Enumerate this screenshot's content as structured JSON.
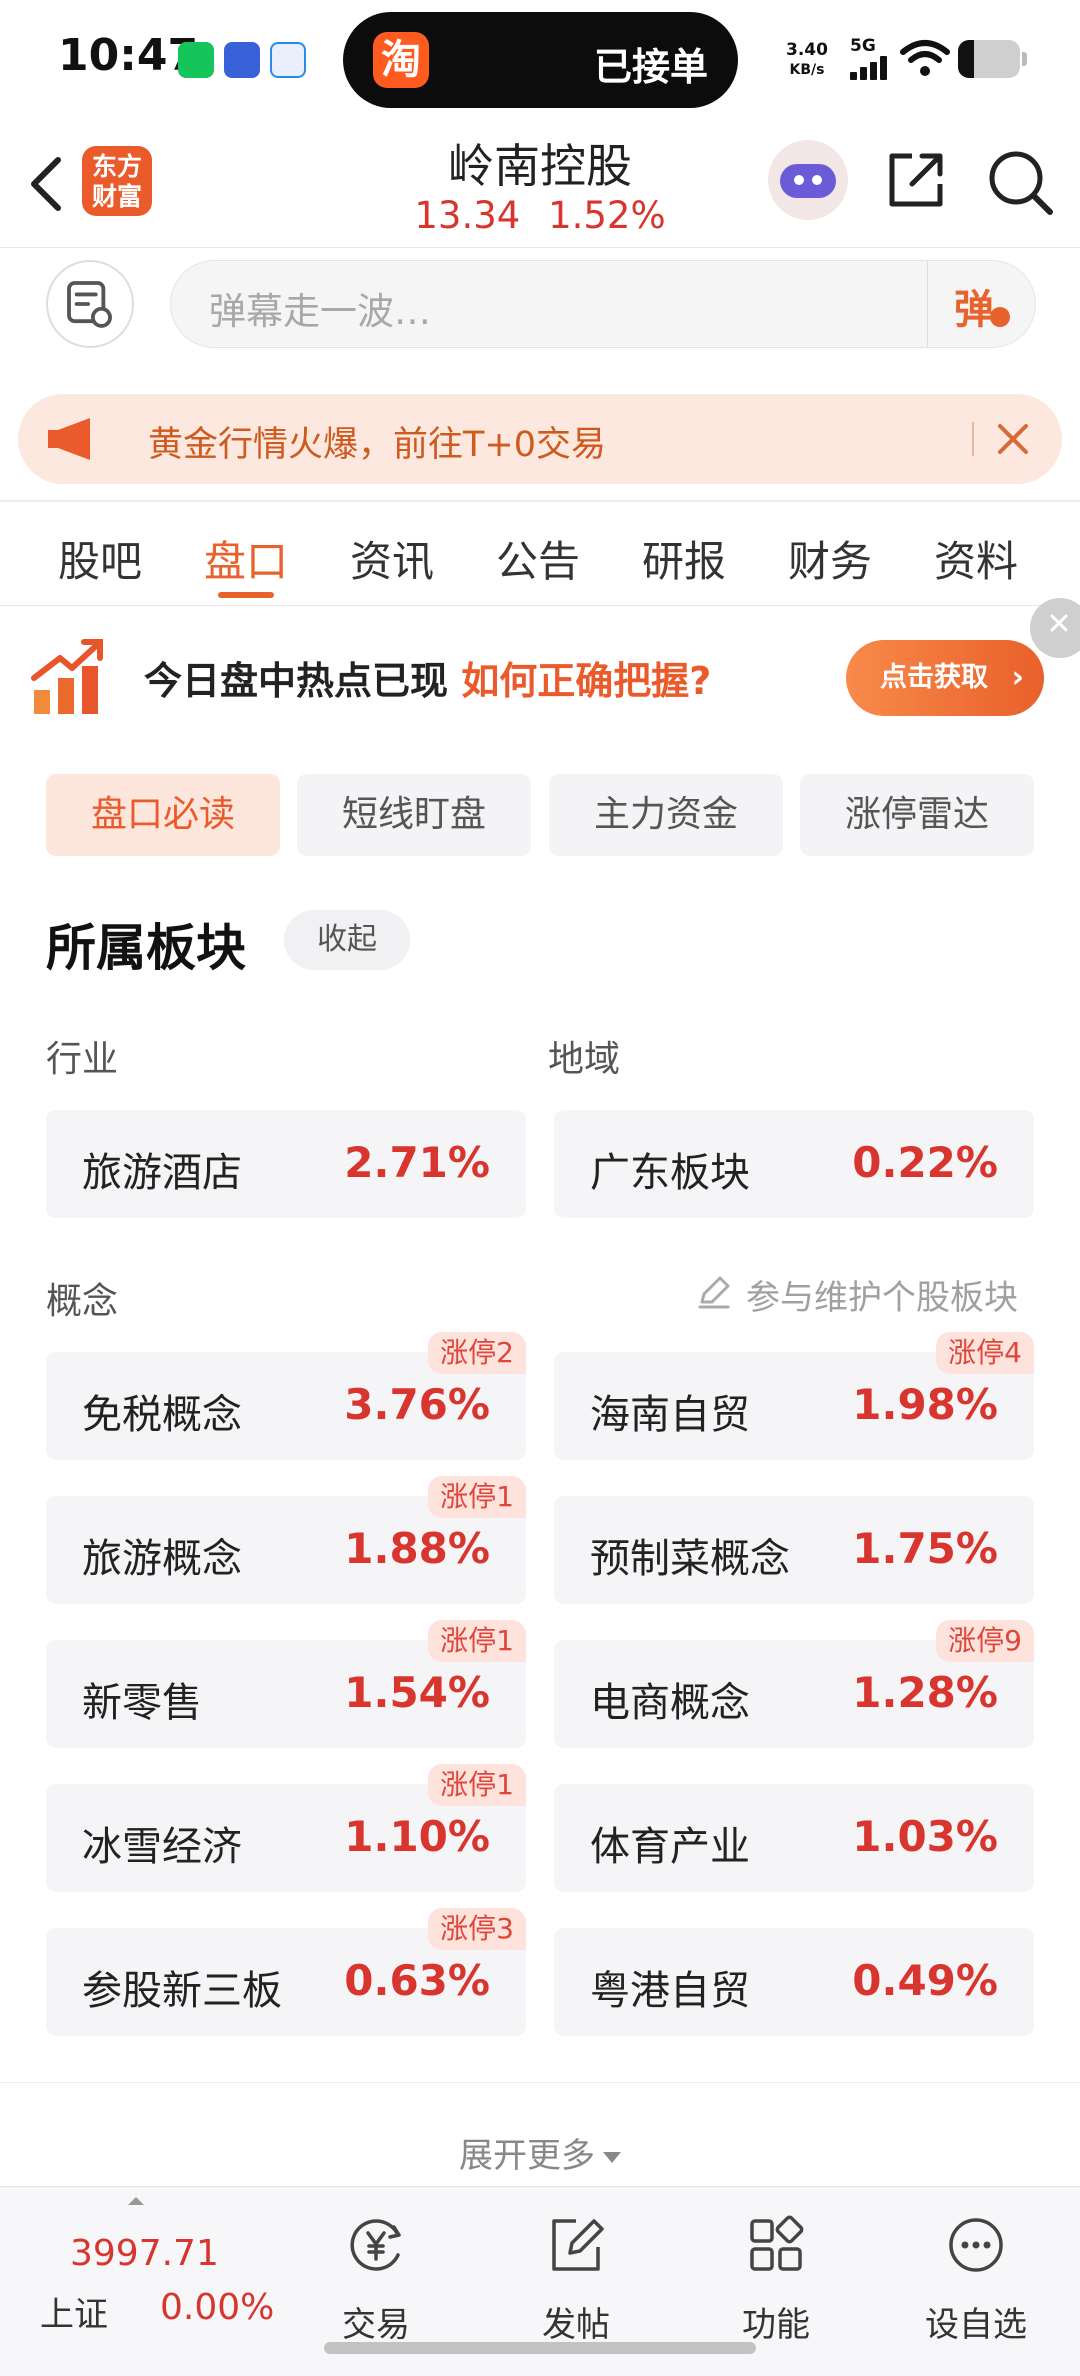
{
  "status_bar": {
    "time": "10:47",
    "island_badge": "淘",
    "island_text": "已接单",
    "net_speed_value": "3.40",
    "net_speed_unit": "KB/s",
    "network": "5G"
  },
  "header": {
    "logo_line1": "东方",
    "logo_line2": "财富",
    "stock_name": "岭南控股",
    "price": "13.34",
    "change_pct": "1.52%"
  },
  "comment_bar": {
    "placeholder": "弹幕走一波…",
    "send_label": "弹"
  },
  "promo": {
    "text": "黄金行情火爆，前往T+0交易"
  },
  "tabs": [
    {
      "label": "股吧"
    },
    {
      "label": "盘口"
    },
    {
      "label": "资讯"
    },
    {
      "label": "公告"
    },
    {
      "label": "研报"
    },
    {
      "label": "财务"
    },
    {
      "label": "资料"
    }
  ],
  "hot_banner": {
    "text_main": "今日盘中热点已现",
    "text_highlight": "如何正确把握?",
    "button": "点击获取"
  },
  "subtabs": [
    {
      "label": "盘口必读"
    },
    {
      "label": "短线盯盘"
    },
    {
      "label": "主力资金"
    },
    {
      "label": "涨停雷达"
    }
  ],
  "section": {
    "title": "所属板块",
    "collapse": "收起",
    "industry_label": "行业",
    "region_label": "地域",
    "concept_label": "概念",
    "maintain_link": "参与维护个股板块"
  },
  "industry": {
    "name": "旅游酒店",
    "pct": "2.71%"
  },
  "region": {
    "name": "广东板块",
    "pct": "0.22%"
  },
  "concepts": [
    {
      "name": "免税概念",
      "pct": "3.76%",
      "badge": "涨停2"
    },
    {
      "name": "海南自贸",
      "pct": "1.98%",
      "badge": "涨停4"
    },
    {
      "name": "旅游概念",
      "pct": "1.88%",
      "badge": "涨停1"
    },
    {
      "name": "预制菜概念",
      "pct": "1.75%",
      "badge": ""
    },
    {
      "name": "新零售",
      "pct": "1.54%",
      "badge": "涨停1"
    },
    {
      "name": "电商概念",
      "pct": "1.28%",
      "badge": "涨停9"
    },
    {
      "name": "冰雪经济",
      "pct": "1.10%",
      "badge": "涨停1"
    },
    {
      "name": "体育产业",
      "pct": "1.03%",
      "badge": ""
    },
    {
      "name": "参股新三板",
      "pct": "0.63%",
      "badge": "涨停3"
    },
    {
      "name": "粤港自贸",
      "pct": "0.49%",
      "badge": ""
    }
  ],
  "expand_more": "展开更多",
  "bottom_bar": {
    "index_value": "3997.71",
    "index_name": "上证",
    "index_pct": "0.00%",
    "nav": [
      {
        "label": "交易",
        "icon": "yuan-circle-icon"
      },
      {
        "label": "发帖",
        "icon": "edit-icon"
      },
      {
        "label": "功能",
        "icon": "grid-icon"
      },
      {
        "label": "设自选",
        "icon": "more-circle-icon"
      }
    ]
  },
  "colors": {
    "accent": "#e8622d",
    "up_red": "#d8352f",
    "badge_bg": "#fde3dc",
    "promo_bg": "#fce8df"
  }
}
